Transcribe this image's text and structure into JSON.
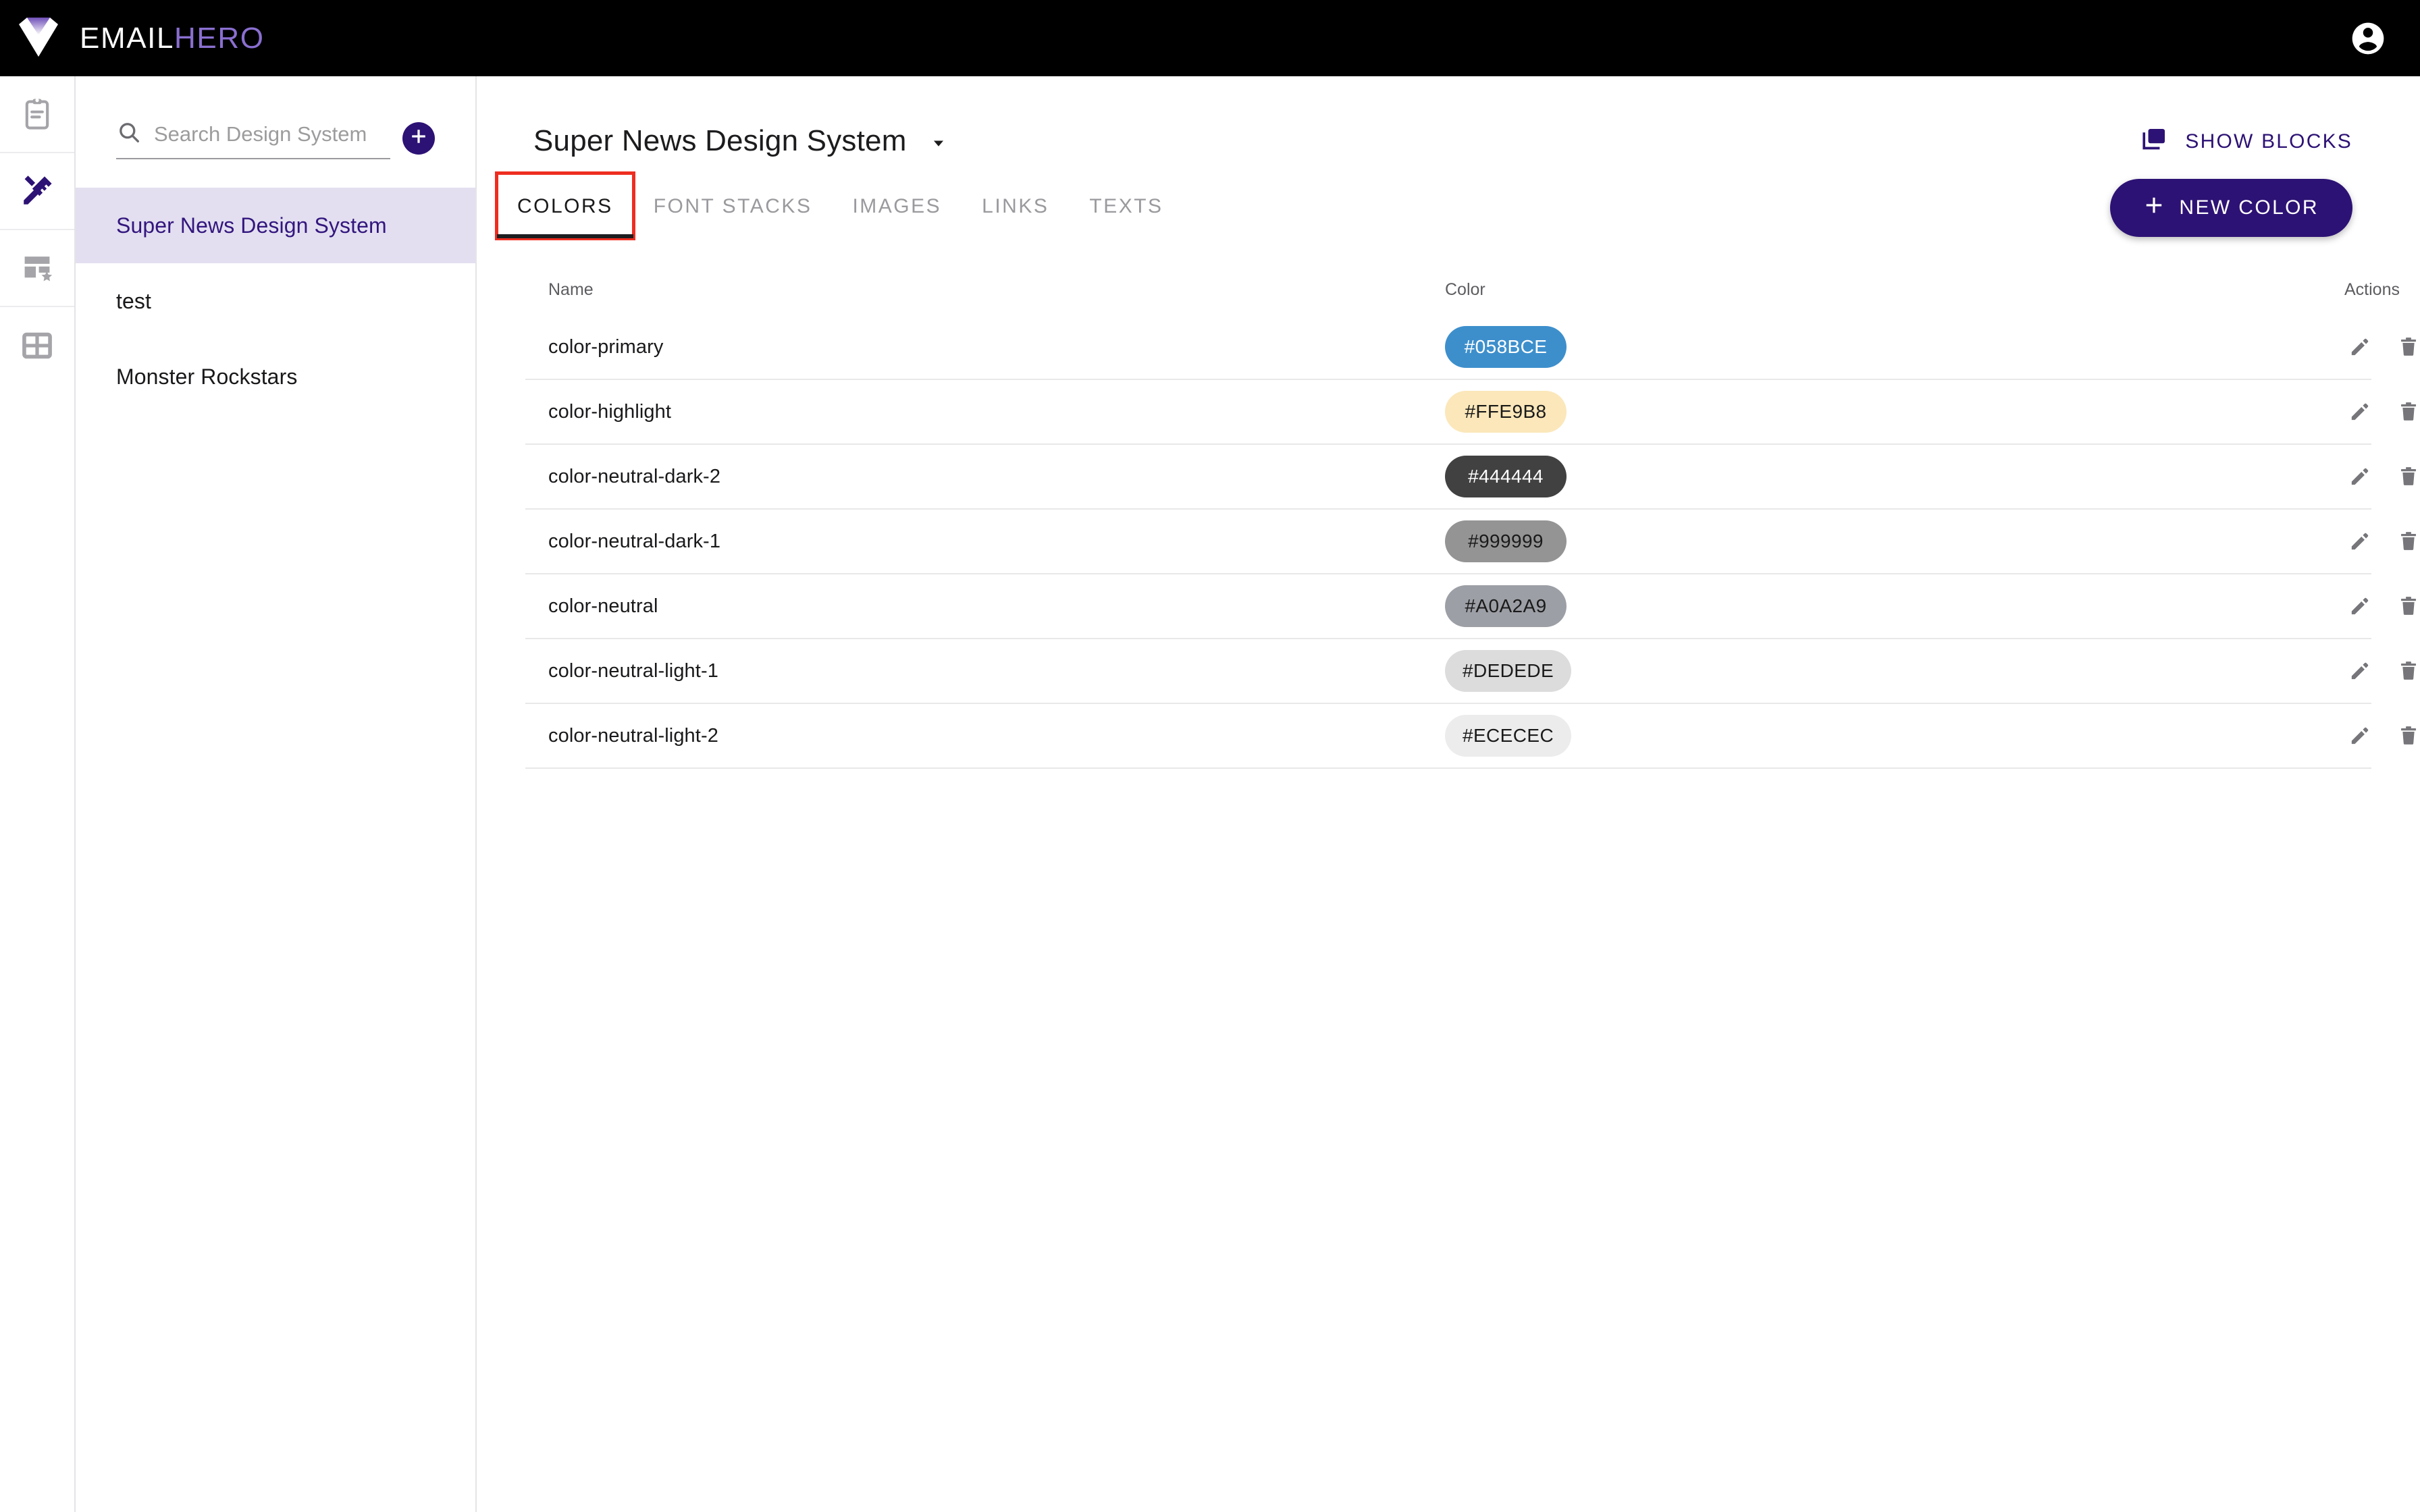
{
  "app": {
    "brand_part1": "EMAIL",
    "brand_part2": "HERO",
    "account_icon": "account-circle-icon",
    "brand_accent": "#8a6fd0",
    "primary": "#2d1275",
    "header_bg": "#000000"
  },
  "rail": {
    "items": [
      {
        "icon": "clipboard-icon",
        "active": false
      },
      {
        "icon": "design-tools-icon",
        "active": true
      },
      {
        "icon": "layout-star-icon",
        "active": false
      },
      {
        "icon": "layout-grid-icon",
        "active": false
      }
    ]
  },
  "sidebar": {
    "search": {
      "icon": "search-icon",
      "placeholder": "Search Design System",
      "value": ""
    },
    "add_button_icon": "plus-icon",
    "items": [
      {
        "label": "Super News Design System",
        "selected": true
      },
      {
        "label": "test",
        "selected": false
      },
      {
        "label": "Monster Rockstars",
        "selected": false
      }
    ]
  },
  "main": {
    "title": "Super News Design System",
    "title_caret_icon": "caret-down-icon",
    "show_blocks": {
      "label": "SHOW BLOCKS",
      "icon": "layers-icon"
    },
    "new_color_button": {
      "label": "NEW COLOR",
      "icon": "plus-icon"
    },
    "tabs": [
      {
        "label": "COLORS",
        "active": true,
        "annotated": true
      },
      {
        "label": "FONT STACKS",
        "active": false,
        "annotated": false
      },
      {
        "label": "IMAGES",
        "active": false,
        "annotated": false
      },
      {
        "label": "LINKS",
        "active": false,
        "annotated": false
      },
      {
        "label": "TEXTS",
        "active": false,
        "annotated": false
      }
    ],
    "table": {
      "headers": [
        "Name",
        "Color",
        "Actions"
      ],
      "row_action_icons": [
        "edit-pencil-icon",
        "delete-trash-icon"
      ],
      "rows": [
        {
          "name": "color-primary",
          "color": "#058BCE",
          "swatch": "#3d8fcc",
          "text_color": "#ffffff"
        },
        {
          "name": "color-highlight",
          "color": "#FFE9B8",
          "swatch": "#fbe7ba",
          "text_color": "#1a1a1a"
        },
        {
          "name": "color-neutral-dark-2",
          "color": "#444444",
          "swatch": "#414141",
          "text_color": "#ffffff"
        },
        {
          "name": "color-neutral-dark-1",
          "color": "#999999",
          "swatch": "#949494",
          "text_color": "#1a1a1a"
        },
        {
          "name": "color-neutral",
          "color": "#A0A2A9",
          "swatch": "#9d9fa6",
          "text_color": "#1a1a1a"
        },
        {
          "name": "color-neutral-light-1",
          "color": "#DEDEDE",
          "swatch": "#dcdcdc",
          "text_color": "#1a1a1a"
        },
        {
          "name": "color-neutral-light-2",
          "color": "#ECECEC",
          "swatch": "#ececec",
          "text_color": "#1a1a1a"
        }
      ]
    }
  },
  "annotation": {
    "color": "#ee2d20",
    "target": "COLORS"
  }
}
